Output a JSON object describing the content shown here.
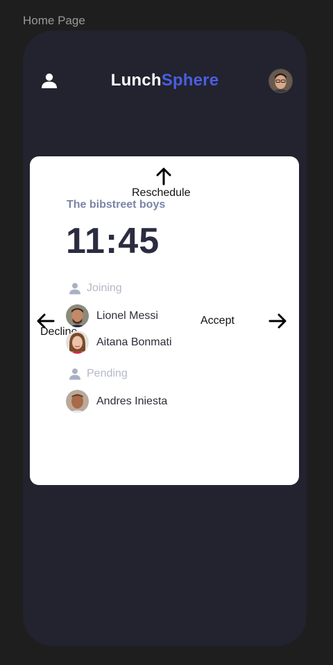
{
  "frame_label": "Home Page",
  "header": {
    "title_part1": "Lunch",
    "title_part2": "Sphere",
    "accent_color": "#4a5ee0",
    "profile_icon": "user-icon"
  },
  "card": {
    "gestures": {
      "up": "Reschedule",
      "left": "Decline",
      "right": "Accept"
    },
    "group_name": "The bibstreet boys",
    "time": "11:45",
    "joining_label": "Joining",
    "joining": [
      {
        "name": "Lionel Messi"
      },
      {
        "name": "Aitana Bonmati"
      }
    ],
    "pending_label": "Pending",
    "pending": [
      {
        "name": "Andres Iniesta"
      }
    ]
  }
}
